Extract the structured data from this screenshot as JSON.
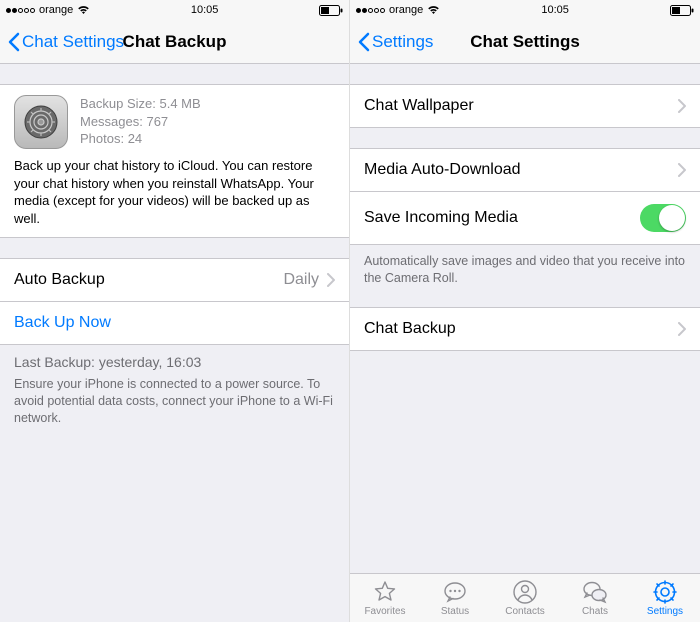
{
  "left": {
    "status": {
      "carrier": "orange",
      "time": "10:05"
    },
    "nav": {
      "back": "Chat Settings",
      "title": "Chat Backup"
    },
    "backup": {
      "size_line": "Backup Size: 5.4 MB",
      "messages_line": "Messages: 767",
      "photos_line": "Photos: 24",
      "desc": "Back up your chat history to iCloud. You can restore your chat history when you reinstall WhatsApp. Your media (except for your videos) will be backed up as well."
    },
    "auto_backup": {
      "label": "Auto Backup",
      "value": "Daily"
    },
    "backup_now": "Back Up Now",
    "footer": {
      "title": "Last Backup: yesterday, 16:03",
      "body": "Ensure your iPhone is connected to a power source. To avoid potential data costs, connect your iPhone to a Wi-Fi network."
    }
  },
  "right": {
    "status": {
      "carrier": "orange",
      "time": "10:05"
    },
    "nav": {
      "back": "Settings",
      "title": "Chat Settings"
    },
    "wallpaper": "Chat Wallpaper",
    "media_auto": "Media Auto-Download",
    "save_incoming": "Save Incoming Media",
    "save_incoming_footer": "Automatically save images and video that you receive into the Camera Roll.",
    "chat_backup": "Chat Backup",
    "tabs": {
      "favorites": "Favorites",
      "status": "Status",
      "contacts": "Contacts",
      "chats": "Chats",
      "settings": "Settings"
    }
  }
}
